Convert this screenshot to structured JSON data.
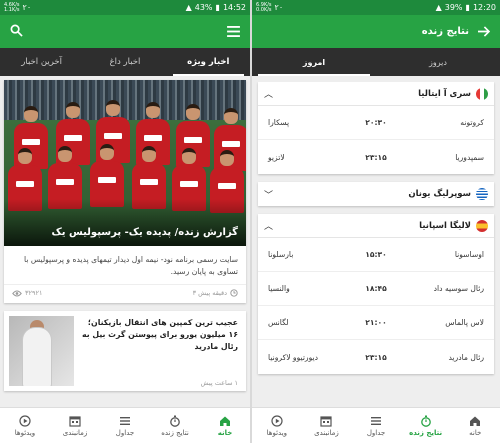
{
  "colors": {
    "primary": "#27a344",
    "statusbar": "#1e8a3c",
    "tabbar": "#2e2e2e"
  },
  "left": {
    "status": {
      "speed_top": "4.6K/s",
      "speed_bottom": "1.1K/s",
      "notif": "۲۰",
      "battery": "43%",
      "time": "14:52"
    },
    "tabs": [
      "آخرین اخبار",
      "اخبار داغ",
      "اخبار ویژه"
    ],
    "active_tab": "اخبار ویژه",
    "hero": {
      "title": "گزارش زنده/ پدیده یک- پرسپولیس یک",
      "summary": "سایت رسمی برنامه نود- نیمه اول دیدار تیمهای پدیده و پرسپولیس با تساوی به پایان رسید.",
      "time": "۳ دقیقه پیش",
      "views": "۳۲۹۲۱"
    },
    "second": {
      "title": "عجیب ترین کمپین های انتقال بازیکنان؛ ۱۶ میلیون یورو برای پیوستن گرث بیل به رئال مادرید",
      "time": "۱ ساعت پیش"
    },
    "nav": [
      "خانه",
      "نتایج زنده",
      "جداول",
      "زمانبندی",
      "ویدئوها"
    ]
  },
  "right": {
    "status": {
      "speed_top": "6.9K/s",
      "speed_bottom": "0.0K/s",
      "notif": "۲۰",
      "battery": "39%",
      "time": "12:20"
    },
    "title": "نتایج زنده",
    "days": [
      "دیروز",
      "امروز"
    ],
    "active_day": "امروز",
    "leagues": [
      {
        "name": "سری آ ایتالیا",
        "flag": "italy-flag",
        "matches": [
          {
            "home": "کروتونه",
            "time": "۲۰:۳۰",
            "away": "پسکارا"
          },
          {
            "home": "سمپدوریا",
            "time": "۲۳:۱۵",
            "away": "لاتزیو"
          }
        ]
      },
      {
        "name": "سوپرلیگ یونان",
        "flag": "greece-flag",
        "matches": []
      },
      {
        "name": "لالیگا اسپانیا",
        "flag": "spain-flag",
        "matches": [
          {
            "home": "اوساسونا",
            "time": "۱۵:۳۰",
            "away": "بارسلونا"
          },
          {
            "home": "رئال سوسیه داد",
            "time": "۱۸:۴۵",
            "away": "والنسیا"
          },
          {
            "home": "لاس پالماس",
            "time": "۲۱:۰۰",
            "away": "لگانس"
          },
          {
            "home": "رئال مادرید",
            "time": "۲۳:۱۵",
            "away": "دیورتیوو لاکرونیا"
          }
        ]
      }
    ],
    "nav": [
      "خانه",
      "نتایج زنده",
      "جداول",
      "زمانبندی",
      "ویدئوها"
    ]
  }
}
